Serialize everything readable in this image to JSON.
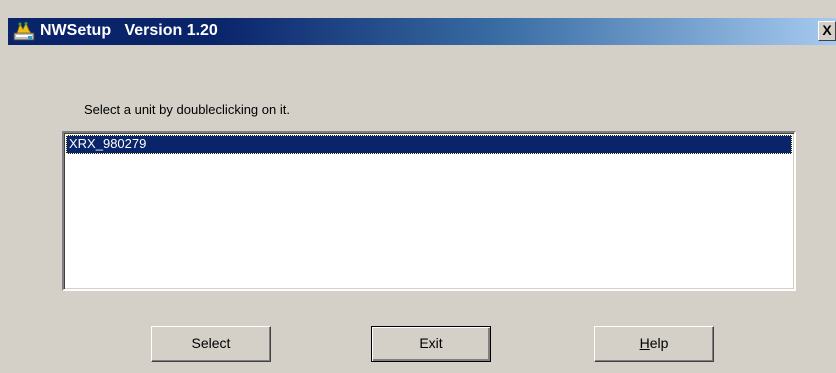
{
  "window": {
    "title": "NWSetup   Version 1.20",
    "close_label": "X",
    "app_icon": "nwsetup-app-icon"
  },
  "instruction": "Select a unit by doubleclicking on it.",
  "units_list": {
    "items": [
      {
        "label": "XRX_980279",
        "selected": true
      }
    ]
  },
  "buttons": {
    "select_label": "Select",
    "exit_label": "Exit",
    "help_mnemonic": "H",
    "help_rest": "elp"
  },
  "colors": {
    "titlebar_start": "#0a246a",
    "titlebar_end": "#a6caf0",
    "face": "#d4d0c8",
    "selection": "#0a246a"
  }
}
